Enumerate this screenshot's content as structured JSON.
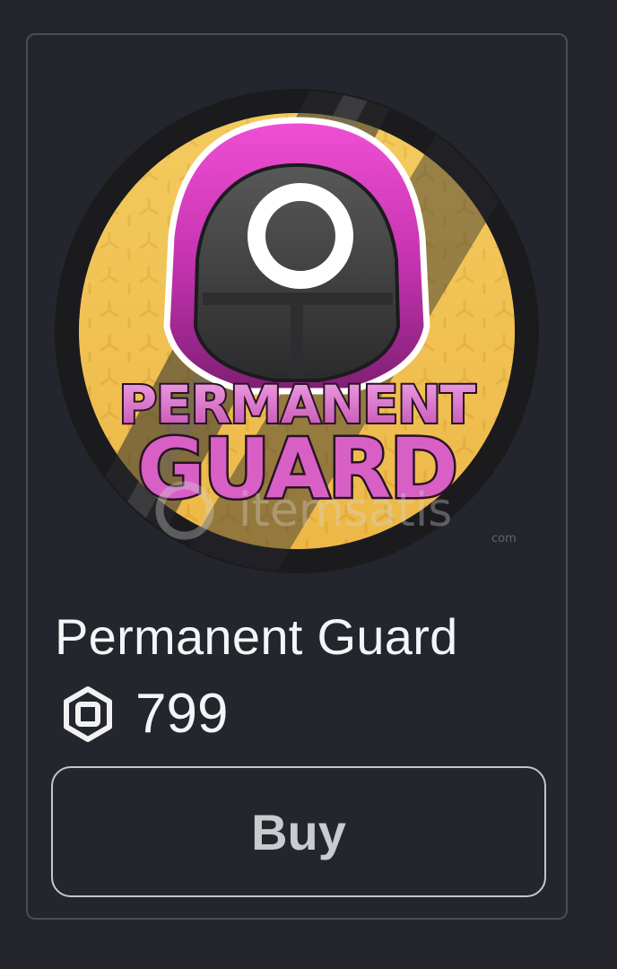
{
  "item": {
    "name": "Permanent Guard",
    "thumbnail": {
      "logo_top_text": "PERMANENT",
      "logo_bottom_text": "GUARD",
      "watermark_text": "itemsatis",
      "watermark_subtext": "com",
      "colors": {
        "pink": "#e23fc8",
        "gold": "#f1c453",
        "dark": "#1a1a1d"
      }
    }
  },
  "price": {
    "currency_icon": "robux-icon",
    "value": "799"
  },
  "actions": {
    "buy_label": "Buy"
  }
}
